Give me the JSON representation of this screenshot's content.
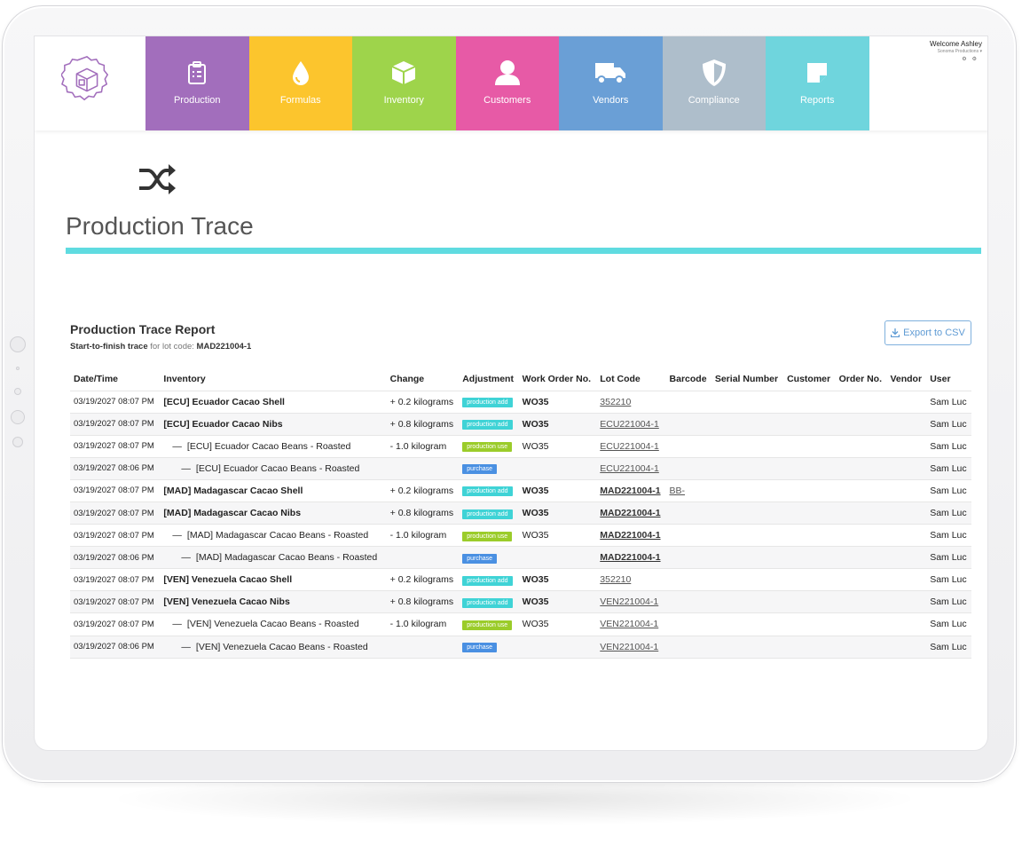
{
  "nav": {
    "items": [
      {
        "label": "Production",
        "color": "#a26ebc",
        "icon": "clipboard-icon"
      },
      {
        "label": "Formulas",
        "color": "#fcc52d",
        "icon": "drop-icon"
      },
      {
        "label": "Inventory",
        "color": "#9ed44b",
        "icon": "box-icon"
      },
      {
        "label": "Customers",
        "color": "#e75aa6",
        "icon": "person-icon"
      },
      {
        "label": "Vendors",
        "color": "#6a9fd6",
        "icon": "truck-icon"
      },
      {
        "label": "Compliance",
        "color": "#aebecb",
        "icon": "shield-icon"
      },
      {
        "label": "Reports",
        "color": "#6fd5dd",
        "icon": "note-icon"
      }
    ]
  },
  "user": {
    "welcome": "Welcome",
    "name": "Ashley",
    "org": "Sonoma Productions ▾"
  },
  "page": {
    "title": "Production Trace"
  },
  "report": {
    "title": "Production Trace Report",
    "subtitle_bold": "Start-to-finish trace",
    "subtitle_mid": " for lot code: ",
    "lot_code": "MAD221004-1",
    "export_label": "Export to CSV"
  },
  "table": {
    "columns": [
      "Date/Time",
      "Inventory",
      "Change",
      "Adjustment",
      "Work Order No.",
      "Lot Code",
      "Barcode",
      "Serial Number",
      "Customer",
      "Order No.",
      "Vendor",
      "User"
    ],
    "rows": [
      {
        "date": "03/19/2027 08:07 PM",
        "level": 0,
        "prefix": "",
        "inventory": "[ECU] Ecuador Cacao Shell",
        "change": "+ 0.2 kilograms",
        "adj": "production add",
        "adj_type": "add",
        "wo": "WO35",
        "wo_bold": true,
        "lot": "352210",
        "lot_bold": false,
        "barcode": "",
        "user": "Sam Luc"
      },
      {
        "date": "03/19/2027 08:07 PM",
        "level": 0,
        "prefix": "",
        "inventory": "[ECU] Ecuador Cacao Nibs",
        "change": "+ 0.8 kilograms",
        "adj": "production add",
        "adj_type": "add",
        "wo": "WO35",
        "wo_bold": true,
        "lot": "ECU221004-1",
        "lot_bold": false,
        "barcode": "",
        "user": "Sam Luc"
      },
      {
        "date": "03/19/2027 08:07 PM",
        "level": 1,
        "prefix": "—",
        "inventory": "[ECU] Ecuador Cacao Beans - Roasted",
        "change": "- 1.0 kilogram",
        "adj": "production use",
        "adj_type": "use",
        "wo": "WO35",
        "wo_bold": false,
        "lot": "ECU221004-1",
        "lot_bold": false,
        "barcode": "",
        "user": "Sam Luc"
      },
      {
        "date": "03/19/2027 08:06 PM",
        "level": 2,
        "prefix": "—",
        "inventory": "[ECU] Ecuador Cacao Beans - Roasted",
        "change": "",
        "adj": "purchase",
        "adj_type": "pur",
        "wo": "",
        "wo_bold": false,
        "lot": "ECU221004-1",
        "lot_bold": false,
        "barcode": "",
        "user": "Sam Luc"
      },
      {
        "date": "03/19/2027 08:07 PM",
        "level": 0,
        "prefix": "",
        "inventory": "[MAD] Madagascar Cacao Shell",
        "change": "+ 0.2 kilograms",
        "adj": "production add",
        "adj_type": "add",
        "wo": "WO35",
        "wo_bold": true,
        "lot": "MAD221004-1",
        "lot_bold": true,
        "barcode": "BB-",
        "user": "Sam Luc"
      },
      {
        "date": "03/19/2027 08:07 PM",
        "level": 0,
        "prefix": "",
        "inventory": "[MAD] Madagascar Cacao Nibs",
        "change": "+ 0.8 kilograms",
        "adj": "production add",
        "adj_type": "add",
        "wo": "WO35",
        "wo_bold": true,
        "lot": "MAD221004-1",
        "lot_bold": true,
        "barcode": "",
        "user": "Sam Luc"
      },
      {
        "date": "03/19/2027 08:07 PM",
        "level": 1,
        "prefix": "—",
        "inventory": "[MAD] Madagascar Cacao Beans - Roasted",
        "change": "- 1.0 kilogram",
        "adj": "production use",
        "adj_type": "use",
        "wo": "WO35",
        "wo_bold": false,
        "lot": "MAD221004-1",
        "lot_bold": true,
        "barcode": "",
        "user": "Sam Luc"
      },
      {
        "date": "03/19/2027 08:06 PM",
        "level": 2,
        "prefix": "—",
        "inventory": "[MAD] Madagascar Cacao Beans - Roasted",
        "change": "",
        "adj": "purchase",
        "adj_type": "pur",
        "wo": "",
        "wo_bold": false,
        "lot": "MAD221004-1",
        "lot_bold": true,
        "barcode": "",
        "user": "Sam Luc"
      },
      {
        "date": "03/19/2027 08:07 PM",
        "level": 0,
        "prefix": "",
        "inventory": "[VEN] Venezuela Cacao Shell",
        "change": "+ 0.2 kilograms",
        "adj": "production add",
        "adj_type": "add",
        "wo": "WO35",
        "wo_bold": true,
        "lot": "352210",
        "lot_bold": false,
        "barcode": "",
        "user": "Sam Luc"
      },
      {
        "date": "03/19/2027 08:07 PM",
        "level": 0,
        "prefix": "",
        "inventory": "[VEN] Venezuela Cacao Nibs",
        "change": "+ 0.8 kilograms",
        "adj": "production add",
        "adj_type": "add",
        "wo": "WO35",
        "wo_bold": true,
        "lot": "VEN221004-1",
        "lot_bold": false,
        "barcode": "",
        "user": "Sam Luc"
      },
      {
        "date": "03/19/2027 08:07 PM",
        "level": 1,
        "prefix": "—",
        "inventory": "[VEN] Venezuela Cacao Beans - Roasted",
        "change": "- 1.0 kilogram",
        "adj": "production use",
        "adj_type": "use",
        "wo": "WO35",
        "wo_bold": false,
        "lot": "VEN221004-1",
        "lot_bold": false,
        "barcode": "",
        "user": "Sam Luc"
      },
      {
        "date": "03/19/2027 08:06 PM",
        "level": 2,
        "prefix": "—",
        "inventory": "[VEN] Venezuela Cacao Beans - Roasted",
        "change": "",
        "adj": "purchase",
        "adj_type": "pur",
        "wo": "",
        "wo_bold": false,
        "lot": "VEN221004-1",
        "lot_bold": false,
        "barcode": "",
        "user": "Sam Luc"
      }
    ]
  },
  "colors": {
    "accent_rule": "#5fdbe0",
    "logo": "#a26ebc"
  }
}
